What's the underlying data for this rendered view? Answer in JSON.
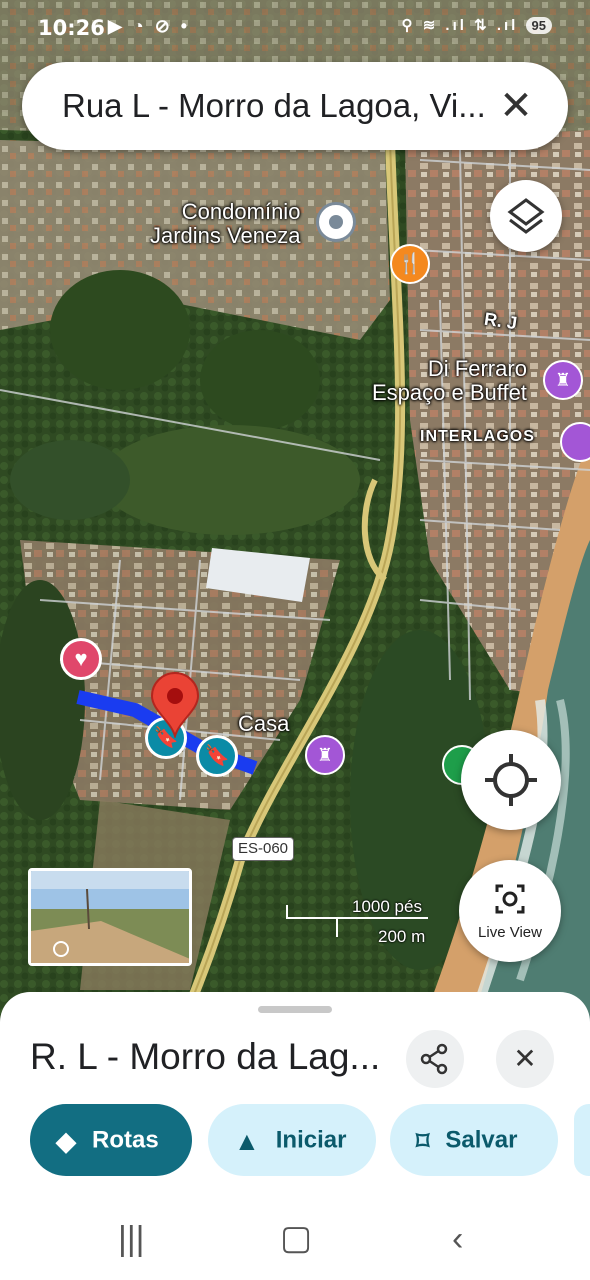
{
  "status_bar": {
    "time": "10:26",
    "left_icons": "▶ ◔ ⊘ •",
    "right_icons": "⚲ ≋ .ıl ⇅ .ıl",
    "battery": "95"
  },
  "search": {
    "query": "Rua L - Morro da Lagoa, Vi...",
    "close_icon": "close-icon"
  },
  "map": {
    "labels": {
      "condominio": "Condomínio\nJardins Veneza",
      "di_ferraro": "Di Ferraro\nEspaço e Buffet",
      "interlagos": "INTERLAGOS",
      "rua_j": "R. J",
      "casa": "Casa",
      "road_shield": "ES-060"
    },
    "scale": {
      "imperial": "1000 pés",
      "metric": "200 m"
    },
    "live_view_label": "Live View",
    "colors": {
      "route": "#1a3cf0",
      "pin": "#ea4335",
      "saved": "#0b8ba6",
      "favorite": "#e0476b",
      "venue": "#a356d6",
      "food": "#f4891f",
      "accent": "#126e82"
    }
  },
  "sheet": {
    "title": "R. L - Morro da Lag...",
    "actions": [
      {
        "label": "Rotas",
        "icon": "directions-icon"
      },
      {
        "label": "Iniciar",
        "icon": "navigation-arrow-icon"
      },
      {
        "label": "Salvar",
        "icon": "bookmark-icon"
      }
    ]
  }
}
